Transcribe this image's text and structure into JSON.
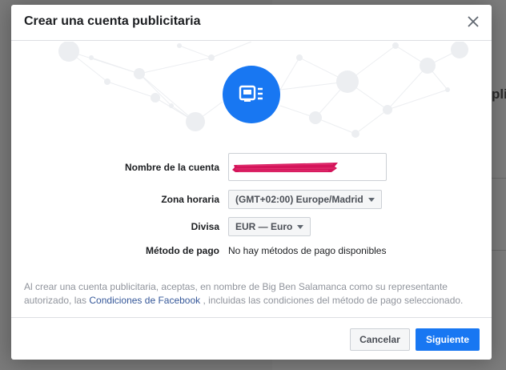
{
  "background": {
    "partial_text": "pli"
  },
  "dialog": {
    "title": "Crear una cuenta publicitaria",
    "close_icon": "close-icon",
    "hero_icon": "ad-account-icon",
    "accent_color": "#1877f2"
  },
  "form": {
    "account_name": {
      "label": "Nombre de la cuenta",
      "value": "",
      "redacted": true
    },
    "timezone": {
      "label": "Zona horaria",
      "selected": "(GMT+02:00) Europe/Madrid"
    },
    "currency": {
      "label": "Divisa",
      "selected": "EUR — Euro"
    },
    "payment_method": {
      "label": "Método de pago",
      "value": "No hay métodos de pago disponibles"
    }
  },
  "disclaimer": {
    "text_before": "Al crear una cuenta publicitaria, aceptas, en nombre de Big Ben Salamanca como su representante autorizado, las ",
    "link": "Condiciones de Facebook",
    "text_after": " , incluidas las condiciones del método de pago seleccionado."
  },
  "footer": {
    "cancel_label": "Cancelar",
    "next_label": "Siguiente"
  }
}
